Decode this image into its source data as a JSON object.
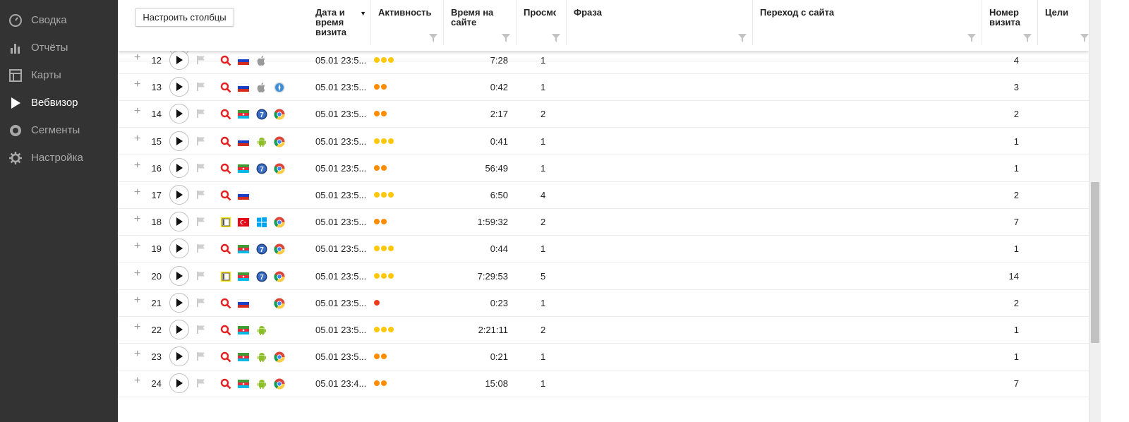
{
  "sidebar": {
    "items": [
      {
        "label": "Сводка",
        "icon": "gauge-icon"
      },
      {
        "label": "Отчёты",
        "icon": "bar-chart-icon"
      },
      {
        "label": "Карты",
        "icon": "map-layout-icon"
      },
      {
        "label": "Вебвизор",
        "icon": "play-icon",
        "active": true
      },
      {
        "label": "Сегменты",
        "icon": "segments-icon"
      },
      {
        "label": "Настройка",
        "icon": "gear-icon"
      }
    ]
  },
  "toolbar": {
    "configure_columns_label": "Настроить столбцы"
  },
  "columns": {
    "date": "Дата и время визита",
    "activity": "Активность",
    "time_on_site": "Время на сайте",
    "views": "Просмотры",
    "phrase": "Фраза",
    "referrer": "Переход с сайта",
    "visit_number": "Номер визита",
    "goals": "Цели"
  },
  "colors": {
    "sidebar_bg": "#333333",
    "activity_high": "#ffc80a",
    "activity_mid": "#ff8c00",
    "activity_low": "#f03c1e",
    "search_icon": "#e62020"
  },
  "rows": [
    {
      "num": "12",
      "source": "search",
      "flag": "ru",
      "os": "apple",
      "browser": "",
      "date": "05.01 23:5...",
      "activity": 3,
      "time": "7:28",
      "views": "1",
      "visit_number": "4"
    },
    {
      "num": "13",
      "source": "search",
      "flag": "ru",
      "os": "apple",
      "browser": "safari",
      "date": "05.01 23:5...",
      "activity": 2,
      "time": "0:42",
      "views": "1",
      "visit_number": "3"
    },
    {
      "num": "14",
      "source": "search",
      "flag": "az",
      "os": "windows7",
      "browser": "chrome",
      "date": "05.01 23:5...",
      "activity": 2,
      "time": "2:17",
      "views": "2",
      "visit_number": "2"
    },
    {
      "num": "15",
      "source": "search",
      "flag": "ru",
      "os": "android",
      "browser": "chrome",
      "date": "05.01 23:5...",
      "activity": 3,
      "time": "0:41",
      "views": "1",
      "visit_number": "1"
    },
    {
      "num": "16",
      "source": "search",
      "flag": "az",
      "os": "windows7",
      "browser": "chrome",
      "date": "05.01 23:5...",
      "activity": 2,
      "time": "56:49",
      "views": "1",
      "visit_number": "1"
    },
    {
      "num": "17",
      "source": "search",
      "flag": "ru",
      "os": "",
      "browser": "",
      "date": "05.01 23:5...",
      "activity": 3,
      "time": "6:50",
      "views": "4",
      "visit_number": "2"
    },
    {
      "num": "18",
      "source": "direct",
      "flag": "tr",
      "os": "windows10",
      "browser": "chrome",
      "date": "05.01 23:5...",
      "activity": 2,
      "time": "1:59:32",
      "views": "2",
      "visit_number": "7"
    },
    {
      "num": "19",
      "source": "search",
      "flag": "az",
      "os": "windows7",
      "browser": "chrome",
      "date": "05.01 23:5...",
      "activity": 3,
      "time": "0:44",
      "views": "1",
      "visit_number": "1"
    },
    {
      "num": "20",
      "source": "direct",
      "flag": "az",
      "os": "windows7",
      "browser": "chrome",
      "date": "05.01 23:5...",
      "activity": 3,
      "time": "7:29:53",
      "views": "5",
      "visit_number": "14"
    },
    {
      "num": "21",
      "source": "search",
      "flag": "ru",
      "os": "",
      "browser": "chrome",
      "date": "05.01 23:5...",
      "activity": 1,
      "time": "0:23",
      "views": "1",
      "visit_number": "2"
    },
    {
      "num": "22",
      "source": "search",
      "flag": "az",
      "os": "android",
      "browser": "",
      "date": "05.01 23:5...",
      "activity": 3,
      "time": "2:21:11",
      "views": "2",
      "visit_number": "1"
    },
    {
      "num": "23",
      "source": "search",
      "flag": "az",
      "os": "android",
      "browser": "chrome",
      "date": "05.01 23:5...",
      "activity": 2,
      "time": "0:21",
      "views": "1",
      "visit_number": "1"
    },
    {
      "num": "24",
      "source": "search",
      "flag": "az",
      "os": "android",
      "browser": "chrome",
      "date": "05.01 23:4...",
      "activity": 2,
      "time": "15:08",
      "views": "1",
      "visit_number": "7"
    }
  ]
}
